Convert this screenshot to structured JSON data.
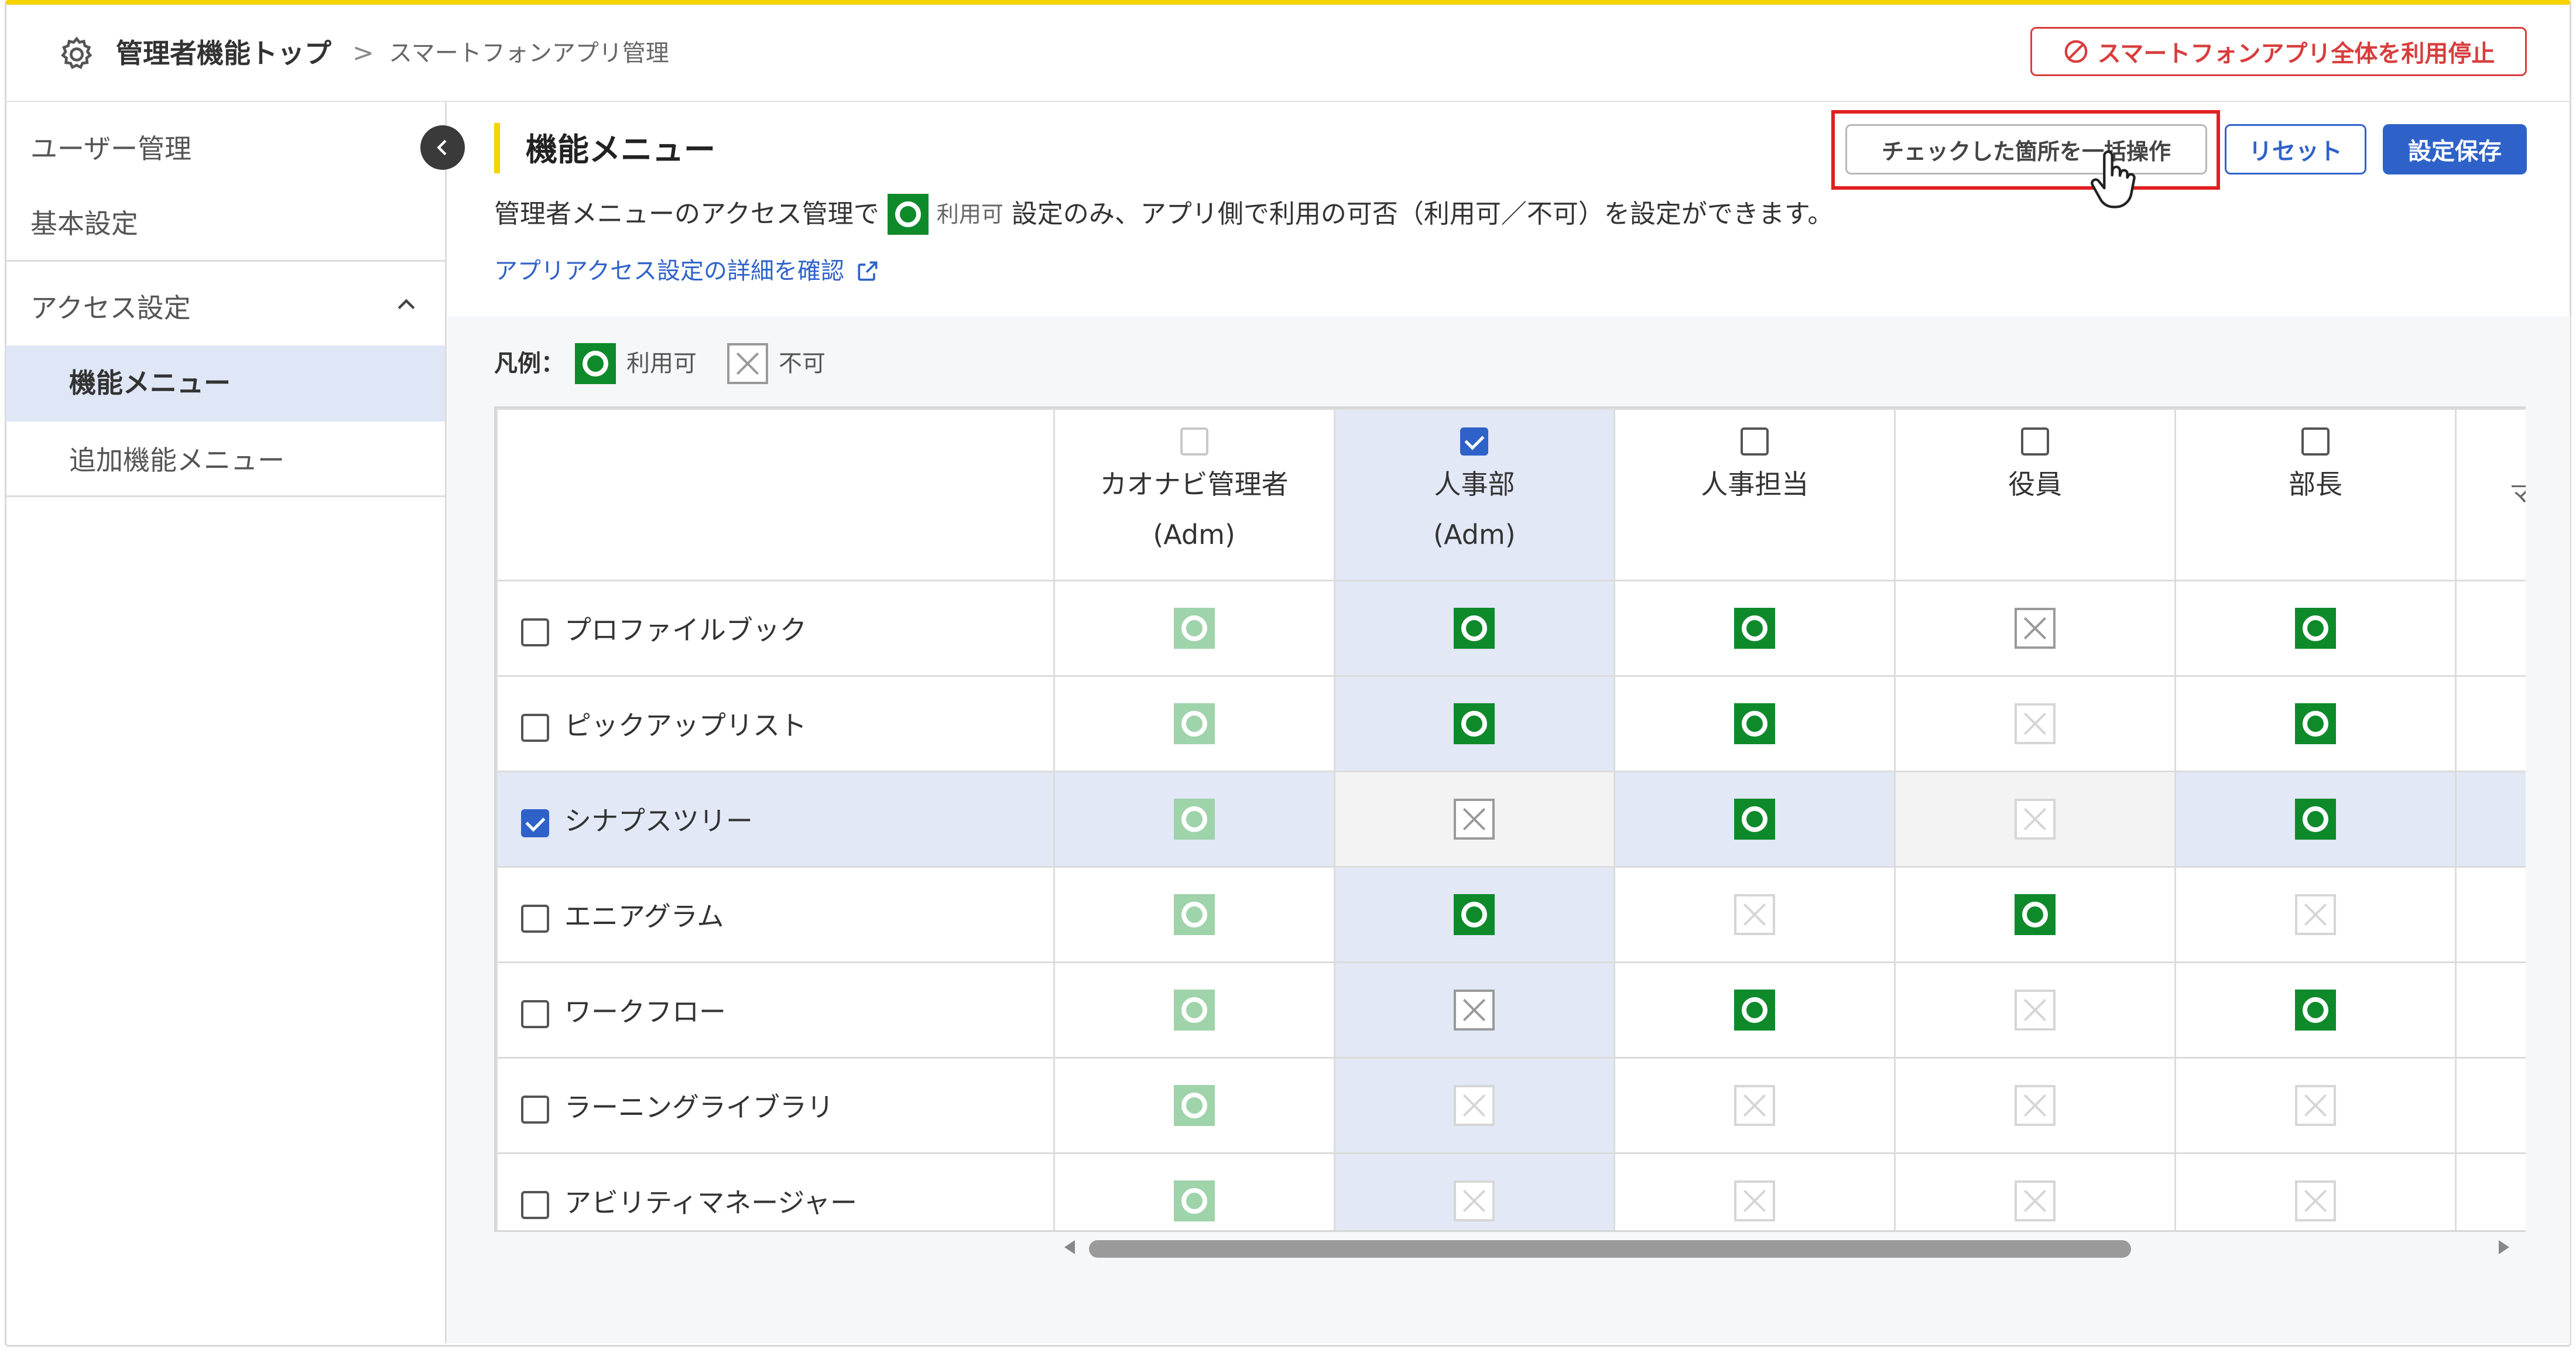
{
  "breadcrumb": {
    "top": "管理者機能トップ",
    "separator": ">",
    "current": "スマートフォンアプリ管理"
  },
  "header": {
    "stop_all_label": "スマートフォンアプリ全体を利用停止"
  },
  "sidebar": {
    "items": [
      {
        "label": "ユーザー管理"
      },
      {
        "label": "基本設定"
      }
    ],
    "access_section": {
      "label": "アクセス設定",
      "expanded": true
    },
    "sub_items": [
      {
        "label": "機能メニュー",
        "active": true
      },
      {
        "label": "追加機能メニュー",
        "active": false
      }
    ]
  },
  "main": {
    "title": "機能メニュー",
    "bulk_button": "チェックした箇所を一括操作",
    "reset_button": "リセット",
    "save_button": "設定保存",
    "description_pre": "管理者メニューのアクセス管理で",
    "description_badge": "利用可",
    "description_post": "設定のみ、アプリ側で利用の可否（利用可／不可）を設定ができます。",
    "detail_link": "アプリアクセス設定の詳細を確認",
    "legend": {
      "title": "凡例：",
      "ok": "利用可",
      "ng": "不可"
    }
  },
  "table": {
    "columns": [
      {
        "name": "カオナビ管理者",
        "sub": "(Adm)",
        "checked": false,
        "disabled": true
      },
      {
        "name": "人事部",
        "sub": "(Adm)",
        "checked": true,
        "disabled": false
      },
      {
        "name": "人事担当",
        "sub": "",
        "checked": false,
        "disabled": false
      },
      {
        "name": "役員",
        "sub": "",
        "checked": false,
        "disabled": false
      },
      {
        "name": "部長",
        "sub": "",
        "checked": false,
        "disabled": false
      }
    ],
    "next_column_partial": "マ",
    "rows": [
      {
        "label": "プロファイルブック",
        "checked": false,
        "cells": [
          "ok-light",
          "ok",
          "ok",
          "ng",
          "ok"
        ]
      },
      {
        "label": "ピックアップリスト",
        "checked": false,
        "cells": [
          "ok-light",
          "ok",
          "ok",
          "ng-light",
          "ok"
        ]
      },
      {
        "label": "シナプスツリー",
        "checked": true,
        "cells": [
          "ok-light",
          "ng",
          "ok",
          "ng-light",
          "ok"
        ]
      },
      {
        "label": "エニアグラム",
        "checked": false,
        "cells": [
          "ok-light",
          "ok",
          "ng-light",
          "ok",
          "ng-light"
        ]
      },
      {
        "label": "ワークフロー",
        "checked": false,
        "cells": [
          "ok-light",
          "ng",
          "ok",
          "ng-light",
          "ok"
        ]
      },
      {
        "label": "ラーニングライブラリ",
        "checked": false,
        "cells": [
          "ok-light",
          "ng-light",
          "ng-light",
          "ng-light",
          "ng-light"
        ]
      },
      {
        "label": "アビリティマネージャー",
        "checked": false,
        "cells": [
          "ok-light",
          "ng-light",
          "ng-light",
          "ng-light",
          "ng-light"
        ]
      }
    ]
  },
  "colors": {
    "accent_blue": "#2f62c9",
    "danger_red": "#d83d3d",
    "ok_green": "#0e8a2b",
    "ok_green_light": "#9fd3aa",
    "highlight": "#e2e8f6",
    "title_bar_yellow": "#f5d400"
  },
  "icons": {
    "gear": "gear-icon",
    "stop": "prohibit-icon",
    "external": "external-link-icon",
    "collapse": "chevron-left-icon",
    "section": "chevron-up-icon",
    "cursor": "hand-pointer-icon"
  }
}
